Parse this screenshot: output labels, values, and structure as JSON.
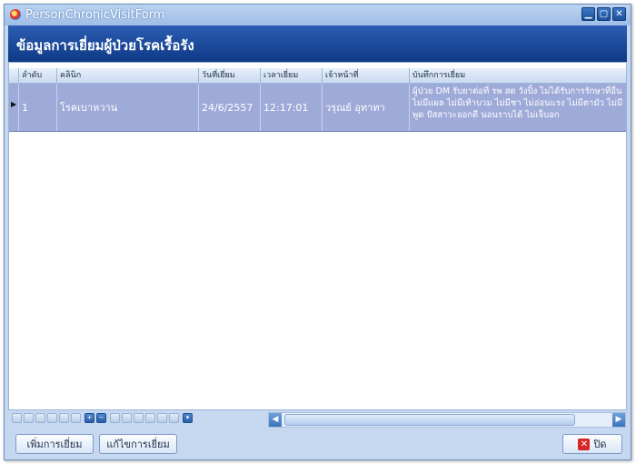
{
  "window": {
    "title": "PersonChronicVisitForm",
    "controls": {
      "minimize": "▁",
      "maximize": "▢",
      "close": "✕"
    }
  },
  "header": {
    "title": "ข้อมูลการเยี่ยมผู้ป่วยโรคเรื้อรัง"
  },
  "grid": {
    "columns": [
      "ลำดับ",
      "คลินิก",
      "วันที่เยี่ยม",
      "เวลาเยี่ยม",
      "เจ้าหน้าที่",
      "บันทึกการเยี่ยม"
    ],
    "rows": [
      {
        "indicator": "▶",
        "order": "1",
        "clinic": "โรคเบาหวาน",
        "date": "24/6/2557",
        "time": "12:17:01",
        "staff": "วรุณย์ อุทาทา",
        "note": "ผู้ป่วย DM รับยาต่อที่ รพ สต วังปิ้ง ไม่ได้รับการรักษาที่อื่น ไม่มีแผล ไม่มีเท้าบวม ไม่มีชา ไม่อ่อนแรง ไม่มีตามัว ไม่มีพูด ปัสสาวะออกดี นอนราบได้ ไม่เจ็บอก"
      }
    ]
  },
  "navigator": {
    "icons": [
      "first",
      "prev-page",
      "prev",
      "next",
      "next-page",
      "last",
      "add",
      "delete",
      "edit",
      "apply",
      "cancel",
      "refresh",
      "bookmark",
      "goto",
      "filter"
    ]
  },
  "footer": {
    "add_visit": "เพิ่มการเยี่ยม",
    "edit_visit": "แก้ไขการเยี่ยม",
    "close": "ปิด"
  },
  "colors": {
    "accent": "#1b4a9b",
    "selected_row": "#9eaad8",
    "frame": "#c5d8ef"
  }
}
